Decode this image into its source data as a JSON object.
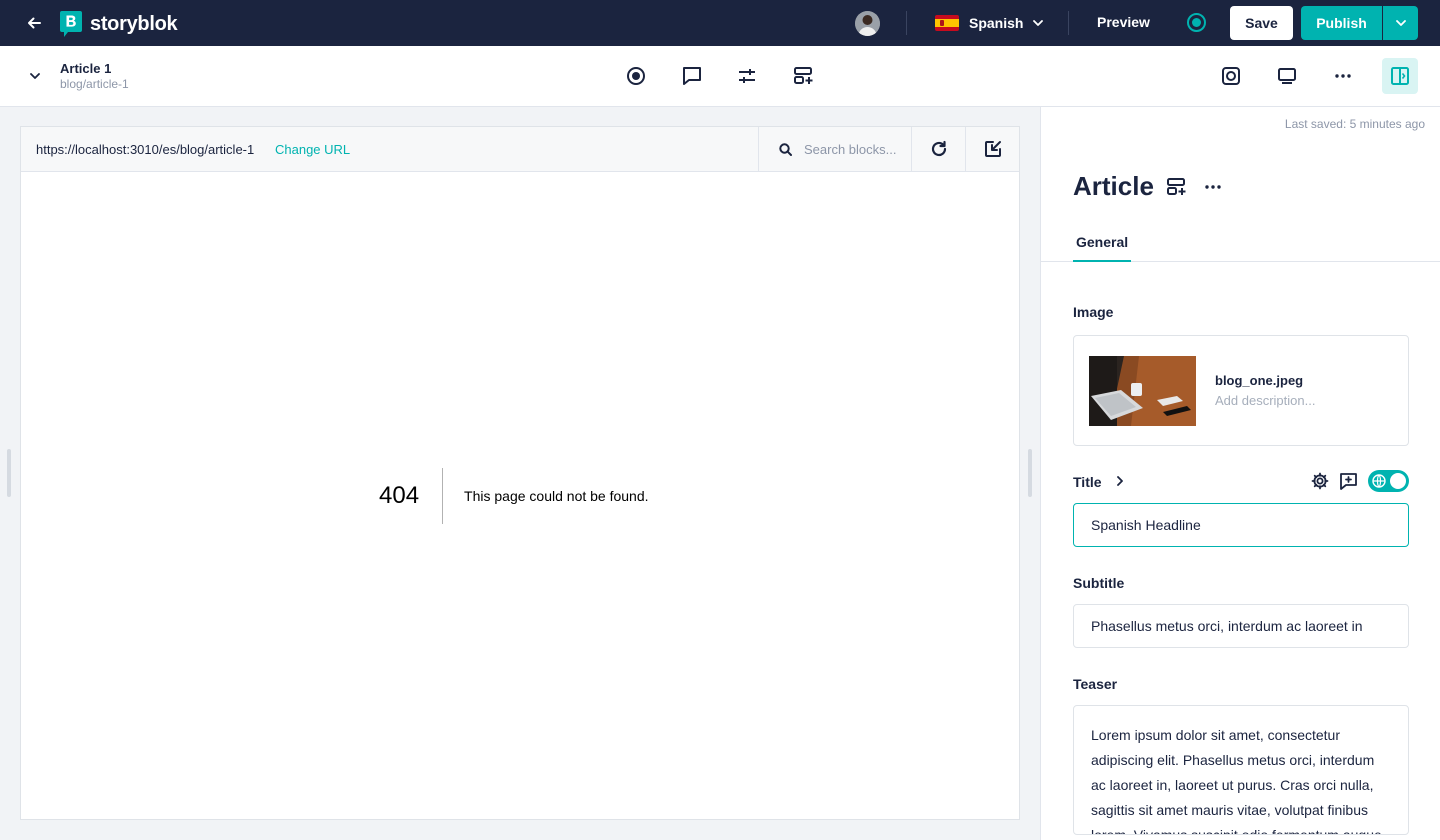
{
  "topbar": {
    "brand": "storyblok",
    "language": "Spanish",
    "preview_label": "Preview",
    "save_label": "Save",
    "publish_label": "Publish"
  },
  "story": {
    "name": "Article 1",
    "slug": "blog/article-1"
  },
  "frame": {
    "url": "https://localhost:3010/es/blog/article-1",
    "change_url_label": "Change URL",
    "search_placeholder": "Search blocks...",
    "error_code": "404",
    "error_message": "This page could not be found."
  },
  "panel": {
    "last_saved": "Last saved: 5 minutes ago",
    "component_title": "Article",
    "tabs": [
      {
        "label": "General"
      }
    ],
    "fields": {
      "image": {
        "label": "Image",
        "filename": "blog_one.jpeg",
        "description_placeholder": "Add description..."
      },
      "title": {
        "label": "Title",
        "value": "Spanish Headline"
      },
      "subtitle": {
        "label": "Subtitle",
        "value": "Phasellus metus orci, interdum ac laoreet in"
      },
      "teaser": {
        "label": "Teaser",
        "value": "Lorem ipsum dolor sit amet, consectetur adipiscing elit. Phasellus metus orci, interdum ac laoreet in, laoreet ut purus. Cras orci nulla, sagittis sit amet mauris vitae, volutpat finibus lorem. Vivamus suscipit odio fermentum augue"
      }
    }
  },
  "colors": {
    "navy": "#1b243f",
    "teal": "#00b3b0",
    "muted": "#8d96a8"
  },
  "icons": [
    "back-arrow-icon",
    "storyblok-logo-icon",
    "chevron-down-icon",
    "live-status-icon",
    "target-icon",
    "comment-icon",
    "sliders-icon",
    "add-block-icon",
    "ai-assistant-icon",
    "desktop-icon",
    "more-icon",
    "side-panel-icon",
    "search-icon",
    "refresh-icon",
    "exit-preview-icon",
    "settings-gear-icon",
    "add-comment-icon",
    "globe-icon",
    "chevron-right-icon"
  ]
}
